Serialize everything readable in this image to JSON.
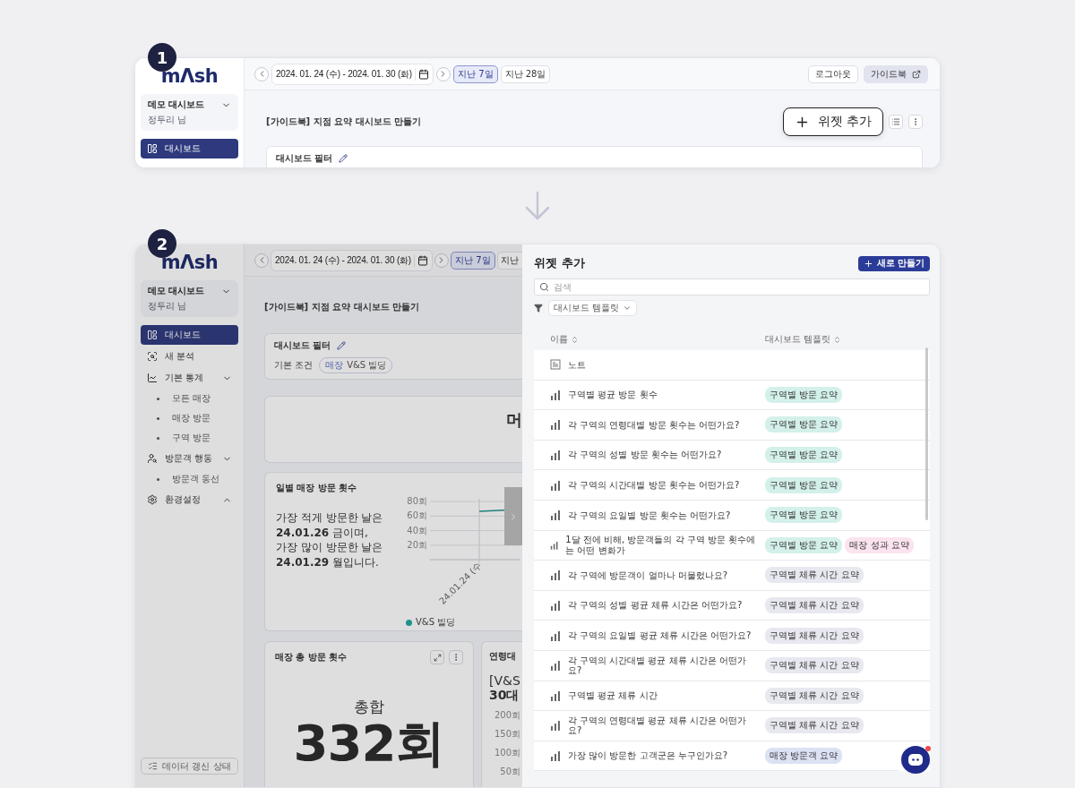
{
  "step_1": {
    "badge": "1",
    "sidebar": {
      "logo": "mΛsh",
      "dashboard": {
        "name": "데모 대시보드",
        "user": "정두리 님"
      },
      "items": [
        {
          "label": "대시보드",
          "selected": true
        }
      ]
    },
    "toolbar": {
      "date_range": "2024. 01. 24 (수) - 2024. 01. 30 (화)",
      "presets": [
        {
          "label": "지난 7일",
          "selected": true
        },
        {
          "label": "지난 28일",
          "selected": false
        }
      ],
      "logout_button": "로그아웃",
      "guide_button": "가이드북"
    },
    "page_title": "[가이드북] 지점 요약 대시보드 만들기",
    "add_widget_button": {
      "label": "위젯 추가",
      "highlighted": true
    },
    "filter_card": {
      "title": "대시보드 필터"
    }
  },
  "step_2": {
    "badge": "2",
    "sidebar": {
      "logo": "mΛsh",
      "dashboard": {
        "name": "데모 대시보드",
        "user": "정두리 님"
      },
      "items": [
        {
          "label": "대시보드",
          "selected": true
        },
        {
          "label": "새 분석",
          "selected": false
        },
        {
          "label": "기본 통계",
          "selected": false,
          "expanded": true,
          "children": [
            {
              "label": "모든 매장",
              "selected": false
            },
            {
              "label": "매장 방문",
              "selected": false
            },
            {
              "label": "구역 방문",
              "selected": false
            }
          ]
        },
        {
          "label": "방문객 행동",
          "selected": false,
          "expanded": true,
          "children": [
            {
              "label": "방문객 동선",
              "selected": false
            }
          ]
        },
        {
          "label": "환경설정",
          "selected": false,
          "expanded": false
        }
      ],
      "refresh_button": "데이터 갱신 상태"
    },
    "toolbar": {
      "date_range": "2024. 01. 24 (수) - 2024. 01. 30 (화)",
      "presets": [
        {
          "label": "지난 7일",
          "selected": true
        },
        {
          "label": "지난",
          "selected": false
        }
      ]
    },
    "page_title": "[가이드북] 지점 요약 대시보드 만들기",
    "filter_card": {
      "title": "대시보드 필터",
      "condition_label": "기본 조건",
      "chip": {
        "key": "매장",
        "value": "V&S 빌딩"
      }
    },
    "headline_card": {
      "text": "머"
    },
    "daily_card": {
      "title": "일별 매장 방문 횟수",
      "summary": "가장 적게 방문한 날은\n**24.01.26** 금이며,\n가장 많이 방문한 날은\n**24.01.29** 월입니다.",
      "chart": {
        "y_axis_labels": [
          "80회",
          "60회",
          "40회",
          "20회"
        ],
        "x_axis_label": "24.01.24 (수",
        "legend": {
          "label": "V&S 빌딩",
          "color": "#1e938b"
        }
      }
    },
    "total_card": {
      "title": "매장 총 방문 횟수",
      "label": "총합",
      "value": "332회"
    },
    "age_card": {
      "title": "연령대",
      "lines": [
        "[V&S",
        "30대"
      ],
      "y_axis_labels": [
        "200회",
        "150회",
        "100회",
        "50회"
      ]
    },
    "drawer": {
      "title": "위젯 추가",
      "new_button": "새로 만들기",
      "search": {
        "placeholder": "검색"
      },
      "filter": {
        "value": "대시보드 템플릿"
      },
      "columns": [
        "이름",
        "대시보드 템플릿"
      ],
      "rows": [
        {
          "kind": "note",
          "name": "노트"
        },
        {
          "kind": "chart",
          "name": "구역별 평균 방문 횟수",
          "tags": [
            {
              "label": "구역별 방문 요약",
              "color": "#d4f0ea"
            }
          ]
        },
        {
          "kind": "chart",
          "name": "각 구역의 연령대별 방문 횟수는 어떤가요?",
          "tags": [
            {
              "label": "구역별 방문 요약",
              "color": "#d4f0ea"
            }
          ]
        },
        {
          "kind": "chart",
          "name": "각 구역의 성별 방문 횟수는 어떤가요?",
          "tags": [
            {
              "label": "구역별 방문 요약",
              "color": "#d4f0ea"
            }
          ]
        },
        {
          "kind": "chart",
          "name": "각 구역의 시간대별 방문 횟수는 어떤가요?",
          "tags": [
            {
              "label": "구역별 방문 요약",
              "color": "#d4f0ea"
            }
          ]
        },
        {
          "kind": "chart",
          "name": "각 구역의 요일별 방문 횟수는 어떤가요?",
          "tags": [
            {
              "label": "구역별 방문 요약",
              "color": "#d4f0ea"
            }
          ]
        },
        {
          "kind": "chart",
          "name": "1달 전에 비해, 방문객들의 각 구역 방문 횟수에는 어떤 변화가",
          "tags": [
            {
              "label": "구역별 방문 요약",
              "color": "#d4f0ea"
            },
            {
              "label": "매장 성과 요약",
              "color": "#fbe3ef"
            }
          ]
        },
        {
          "kind": "chart",
          "name": "각 구역에 방문객이 얼마나 머물렀나요?",
          "tags": [
            {
              "label": "구역별 체류 시간 요약",
              "color": "#e8e8f0"
            }
          ]
        },
        {
          "kind": "chart",
          "name": "각 구역의 성별 평균 체류 시간은 어떤가요?",
          "tags": [
            {
              "label": "구역별 체류 시간 요약",
              "color": "#e8e8f0"
            }
          ]
        },
        {
          "kind": "chart",
          "name": "각 구역의 요일별 평균 체류 시간은 어떤가요?",
          "tags": [
            {
              "label": "구역별 체류 시간 요약",
              "color": "#e8e8f0"
            }
          ]
        },
        {
          "kind": "chart",
          "name": "각 구역의 시간대별 평균 체류 시간은 어떤가요?",
          "tags": [
            {
              "label": "구역별 체류 시간 요약",
              "color": "#e8e8f0"
            }
          ]
        },
        {
          "kind": "chart",
          "name": "구역별 평균 체류 시간",
          "tags": [
            {
              "label": "구역별 체류 시간 요약",
              "color": "#e8e8f0"
            }
          ]
        },
        {
          "kind": "chart",
          "name": "각 구역의 연령대별 평균 체류 시간은 어떤가요?",
          "tags": [
            {
              "label": "구역별 체류 시간 요약",
              "color": "#e8e8f0"
            }
          ]
        },
        {
          "kind": "chart",
          "name": "가장 많이 방문한 고객군은 누구인가요?",
          "tags": [
            {
              "label": "매장 방문객 요약",
              "color": "#dce2f4"
            }
          ]
        }
      ]
    }
  }
}
